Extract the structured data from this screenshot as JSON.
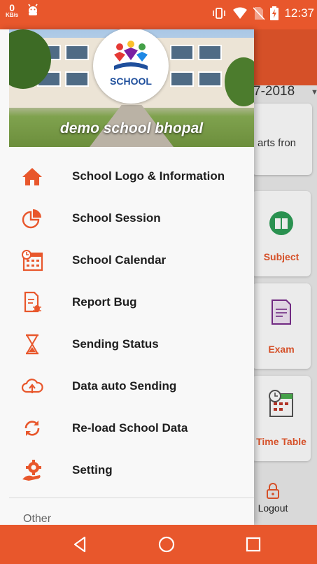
{
  "status_bar": {
    "speed_value": "0",
    "speed_unit": "KB/s",
    "time": "12:37"
  },
  "background": {
    "year_text": "7-2018",
    "notice_text": "arts fron",
    "tiles": [
      {
        "label": "Subject",
        "icon": "book-icon"
      },
      {
        "label": "Exam",
        "icon": "exam-sheet-icon"
      },
      {
        "label": "Time Table",
        "icon": "timetable-icon"
      }
    ],
    "logout_label": "Logout"
  },
  "drawer": {
    "logo_text": "SCHOOL",
    "school_name": "demo school bhopal",
    "menu_items": [
      {
        "label": "School Logo & Information",
        "icon": "home-icon"
      },
      {
        "label": "School Session",
        "icon": "pie-chart-icon"
      },
      {
        "label": "School Calendar",
        "icon": "calendar-icon"
      },
      {
        "label": "Report Bug",
        "icon": "bug-report-icon"
      },
      {
        "label": "Sending Status",
        "icon": "hourglass-icon"
      },
      {
        "label": "Data auto Sending",
        "icon": "cloud-upload-icon"
      },
      {
        "label": "Re-load School Data",
        "icon": "reload-icon"
      },
      {
        "label": "Setting",
        "icon": "settings-gear-icon"
      }
    ],
    "section_label": "Other"
  },
  "colors": {
    "accent": "#e8572c",
    "drawer_bg": "#f8f8f8"
  }
}
